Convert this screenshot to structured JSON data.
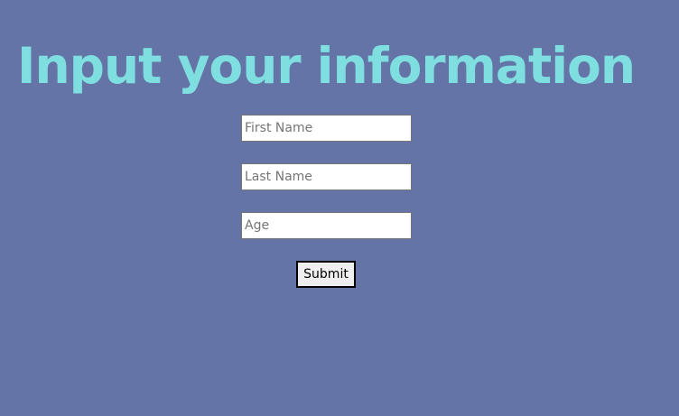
{
  "page": {
    "title": "Input your information",
    "background_color": "#6474a6",
    "title_color": "#7fdfe0"
  },
  "form": {
    "first_name": {
      "value": "",
      "placeholder": "First Name"
    },
    "last_name": {
      "value": "",
      "placeholder": "Last Name"
    },
    "age": {
      "value": "",
      "placeholder": "Age"
    },
    "submit_label": "Submit"
  }
}
